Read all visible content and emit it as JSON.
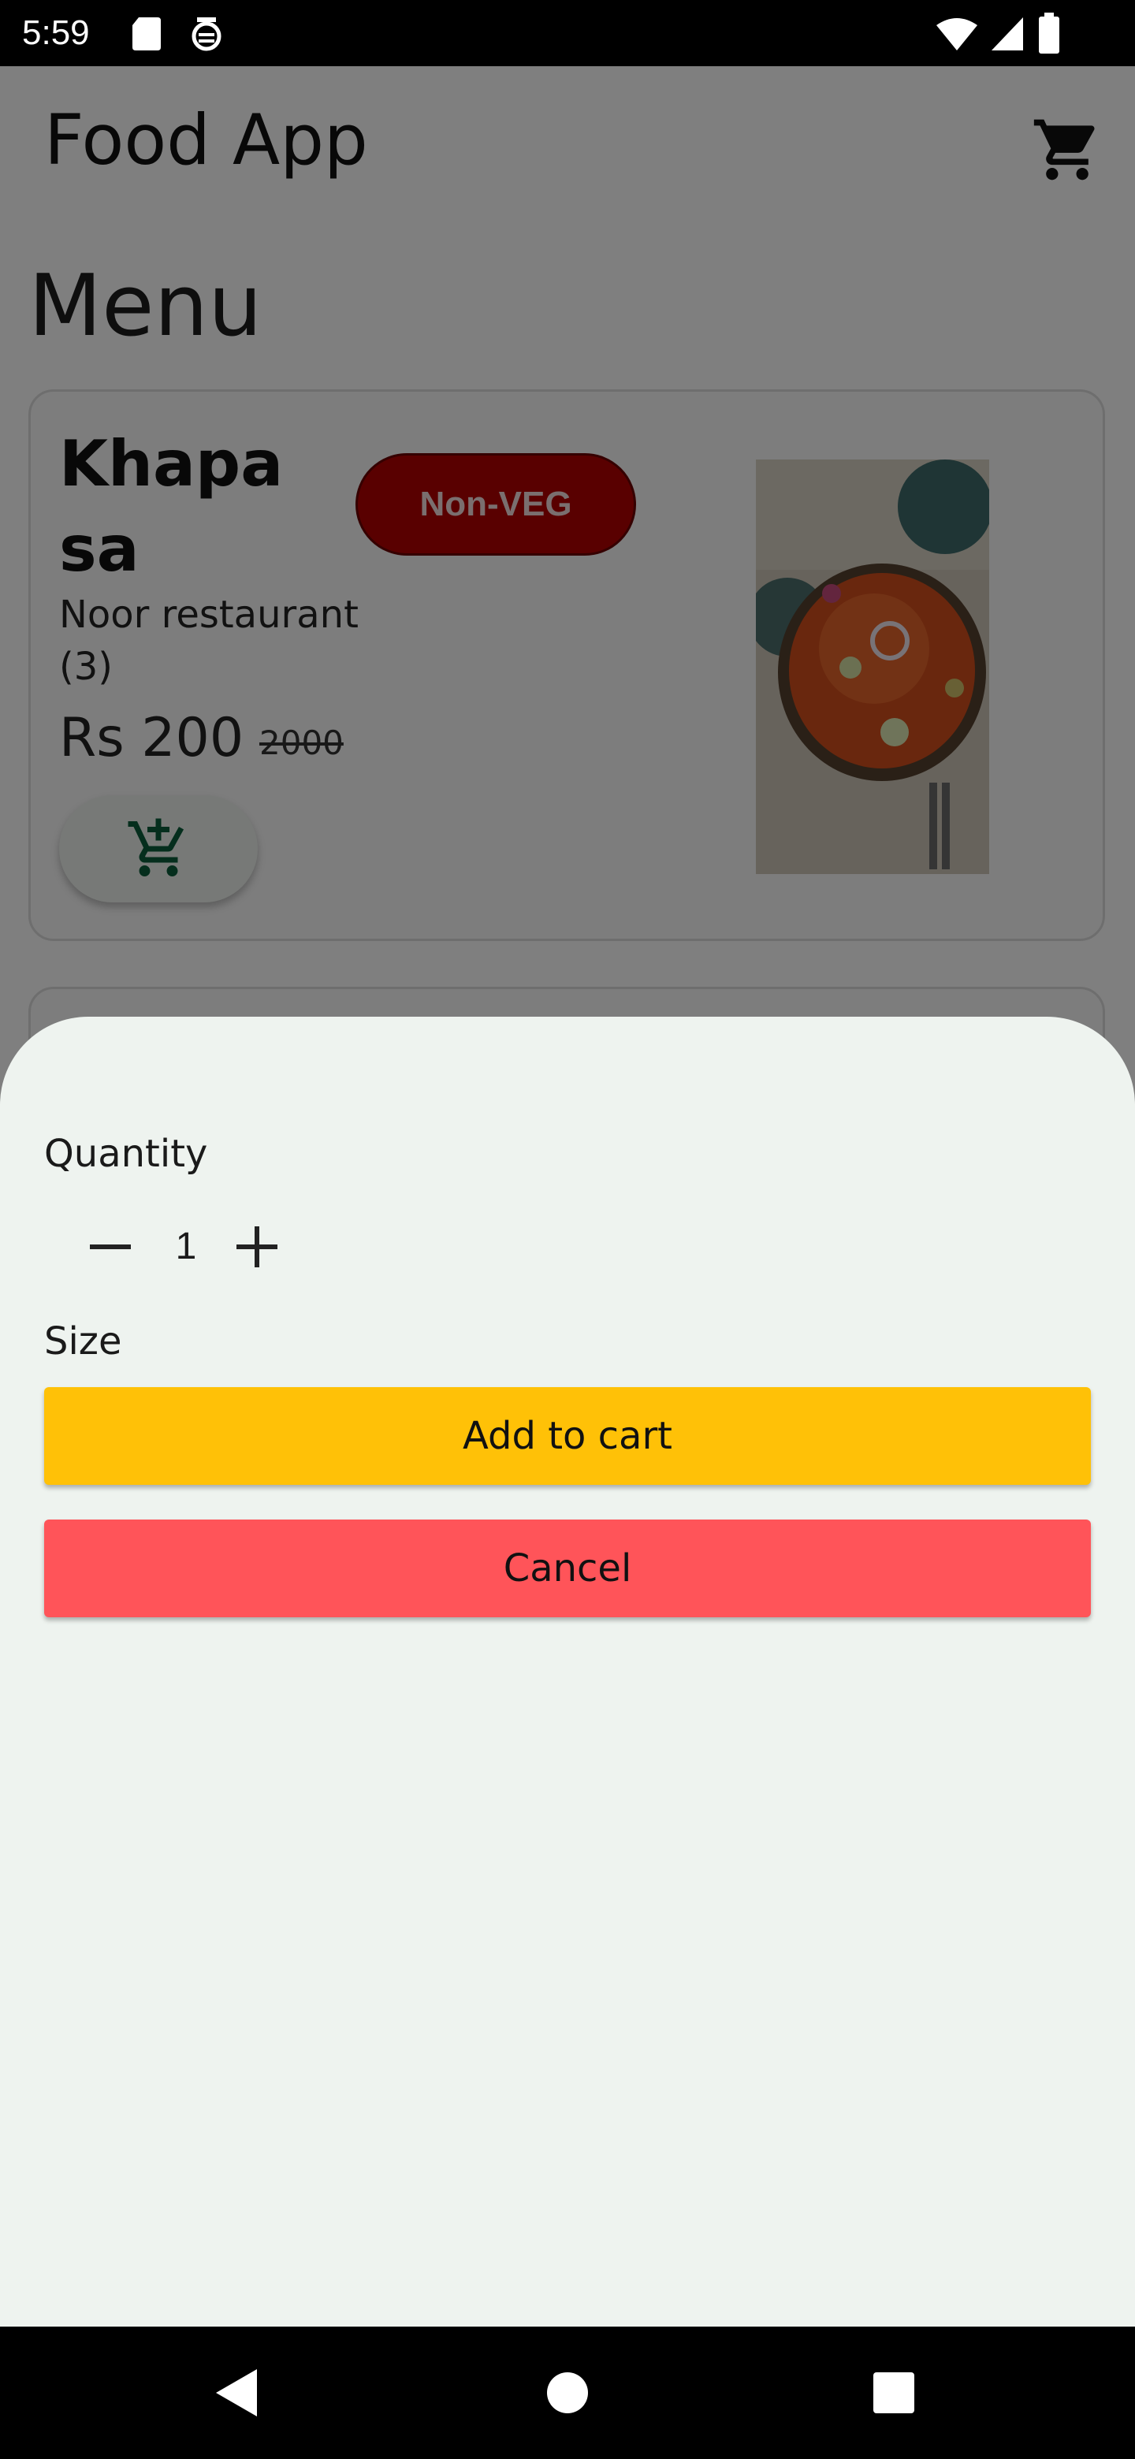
{
  "status_bar": {
    "time": "5:59",
    "icons": [
      "sd-card-icon",
      "notification-icon",
      "wifi-icon",
      "signal-icon",
      "battery-icon"
    ]
  },
  "app_bar": {
    "title": "Food App",
    "cart_icon": "shopping-cart-icon"
  },
  "menu": {
    "heading": "Menu",
    "items": [
      {
        "name": "Khapasa",
        "badge": "Non-VEG",
        "restaurant": "Noor restaurant",
        "rating": "(3)",
        "price": "Rs 200",
        "original_price": "2000",
        "add_icon": "add-shopping-cart-icon"
      }
    ]
  },
  "sheet": {
    "quantity_label": "Quantity",
    "quantity_value": "1",
    "size_label": "Size",
    "add_button": "Add to cart",
    "cancel_button": "Cancel"
  },
  "colors": {
    "badge": "#b30000",
    "add_button": "#ffc107",
    "cancel_button": "#ff5459",
    "sheet_bg": "#eef3ef"
  },
  "nav_bar": {
    "icons": [
      "back-icon",
      "home-icon",
      "recents-icon"
    ]
  }
}
